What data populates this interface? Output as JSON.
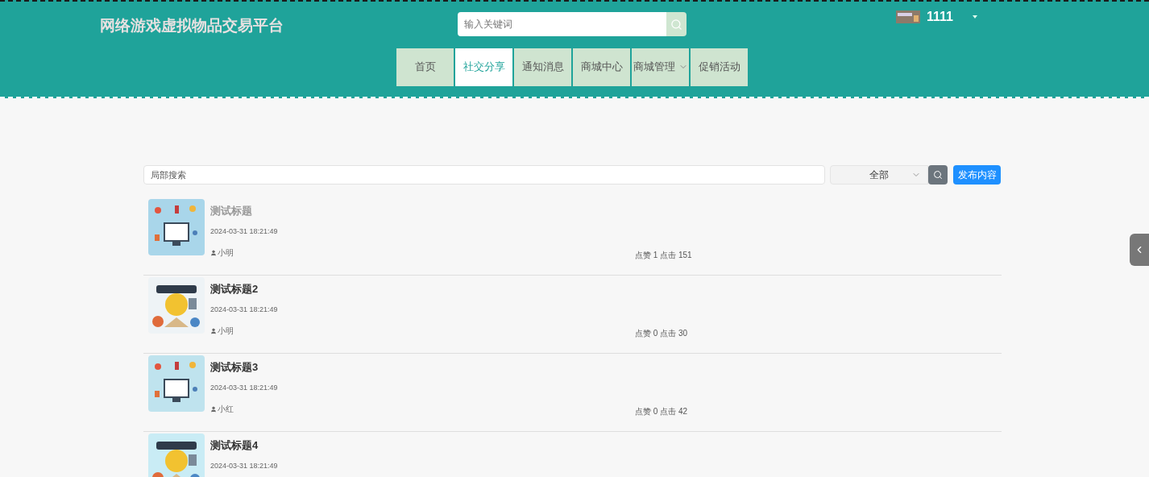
{
  "site_title": "网络游戏虚拟物品交易平台",
  "header_search": {
    "placeholder": "输入关键词"
  },
  "user": {
    "name": "1111"
  },
  "nav": [
    {
      "label": "首页",
      "selected": false,
      "has_dropdown": false
    },
    {
      "label": "社交分享",
      "selected": true,
      "has_dropdown": false
    },
    {
      "label": "通知消息",
      "selected": false,
      "has_dropdown": false
    },
    {
      "label": "商城中心",
      "selected": false,
      "has_dropdown": false
    },
    {
      "label": "商城管理",
      "selected": false,
      "has_dropdown": true
    },
    {
      "label": "促销活动",
      "selected": false,
      "has_dropdown": false
    }
  ],
  "filter": {
    "search_placeholder": "局部搜索",
    "category": "全部",
    "publish_button": "发布内容"
  },
  "posts": [
    {
      "title": "测试标题",
      "hovered": true,
      "date": "2024-03-31 18:21:49",
      "author": "小明",
      "stats": "点赞 1 点击 151"
    },
    {
      "title": "测试标题2",
      "hovered": false,
      "date": "2024-03-31 18:21:49",
      "author": "小明",
      "stats": "点赞 0 点击 30"
    },
    {
      "title": "测试标题3",
      "hovered": false,
      "date": "2024-03-31 18:21:49",
      "author": "小红",
      "stats": "点赞 0 点击 42"
    },
    {
      "title": "测试标题4",
      "hovered": false,
      "date": "2024-03-31 18:21:49"
    }
  ]
}
